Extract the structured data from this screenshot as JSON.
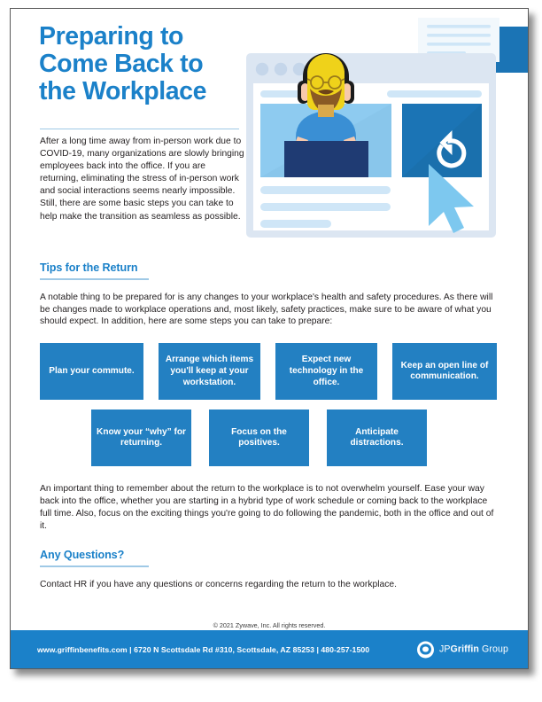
{
  "hero": {
    "title_lines": [
      "Preparing to",
      "Come Back to",
      "the Workplace"
    ],
    "title": "Preparing to Come Back to the Workplace",
    "paragraph": "After a long time away from in-person work due to COVID-19, many organizations are slowly bringing employees back into the office. If you are returning, eliminating the stress of in-person work and social interactions seems nearly impossible. Still, there are some basic steps you can take to help make the transition as seamless as possible."
  },
  "tips_section": {
    "heading": "Tips for the Return",
    "intro": "A notable thing to be prepared for is any changes to your workplace's health and safety procedures. As there will be changes made to workplace operations and, most likely, safety practices, make sure to be aware of what you should expect. In addition, here are some steps you can take to prepare:",
    "boxes_row1": [
      "Plan your commute.",
      "Arrange which items you'll keep at your workstation.",
      "Expect new technology in the office.",
      "Keep an open line of communication."
    ],
    "boxes_row2": [
      "Know your “why” for returning.",
      "Focus on the positives.",
      "Anticipate distractions."
    ],
    "closing": "An important thing to remember about the return to the workplace is to not overwhelm yourself. Ease your way back into the office, whether you are starting in a hybrid type of work schedule or coming back to the workplace full time. Also, focus on the exciting things you're going to do following the pandemic, both in the office and out of it."
  },
  "questions_section": {
    "heading": "Any Questions?",
    "body": "Contact HR if you have any questions or concerns regarding the return to the workplace."
  },
  "copyright": "© 2021 Zywave, Inc. All rights reserved.",
  "footer": {
    "contact": "www.griffinbenefits.com | 6720 N Scottsdale Rd #310, Scottsdale, AZ 85253 | 480-257-1500",
    "logo_prefix": "JP",
    "logo_bold": "Griffin",
    "logo_suffix": " Group"
  },
  "colors": {
    "brand_blue": "#1b81c9",
    "box_blue": "#2380c2",
    "rule_blue": "#9fc9e6",
    "text": "#231f20"
  },
  "illustration": {
    "name": "video-conference-illustration",
    "elements": [
      "browser-window",
      "video-tile-person",
      "video-tile-cursor",
      "speech-bubbles",
      "text-placeholder-lines"
    ]
  }
}
